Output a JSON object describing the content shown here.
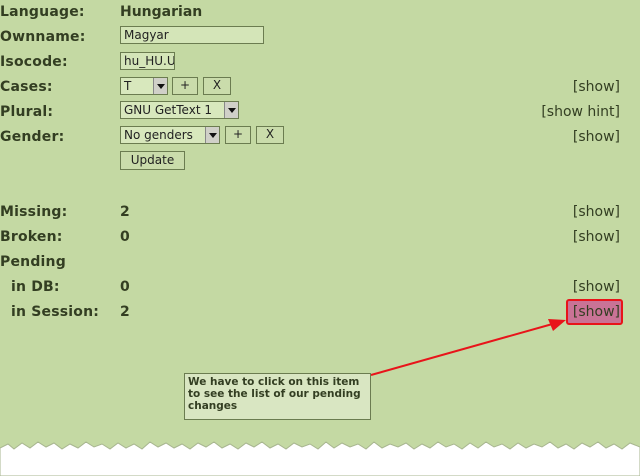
{
  "labels": {
    "language": "Language:",
    "ownname": "Ownname:",
    "isocode": "Isocode:",
    "cases": "Cases:",
    "plural": "Plural:",
    "gender": "Gender:",
    "missing": "Missing:",
    "broken": "Broken:",
    "pending": "Pending",
    "in_db": "in DB:",
    "in_session": "in Session:"
  },
  "values": {
    "language": "Hungarian",
    "ownname": "Magyar",
    "isocode": "hu_HU.U",
    "cases_selected": "T",
    "plural_selected": "GNU GetText 1",
    "gender_selected": "No genders",
    "missing": "2",
    "broken": "0",
    "in_db": "0",
    "in_session": "2"
  },
  "buttons": {
    "add": "+",
    "remove": "X",
    "update": "Update"
  },
  "links": {
    "show": "[show]",
    "show_hint": "[show hint]"
  },
  "callout": {
    "text": "We have to click on this item to see the list of our pending changes"
  },
  "colors": {
    "background": "#c4d9a3",
    "highlight_border": "#e8141a",
    "highlight_fill": "#c97396"
  }
}
